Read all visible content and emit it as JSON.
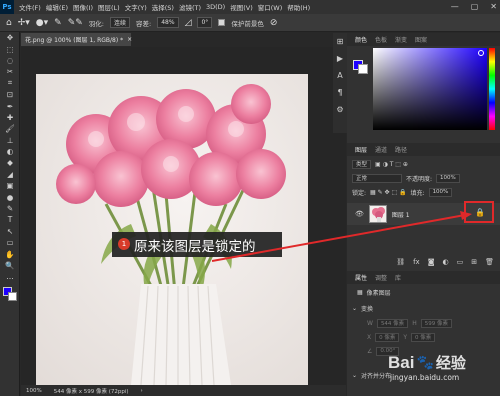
{
  "menubar": {
    "logo": "Ps",
    "items": [
      "文件(F)",
      "编辑(E)",
      "图像(I)",
      "图层(L)",
      "文字(Y)",
      "选择(S)",
      "滤镜(T)",
      "3D(D)",
      "视图(V)",
      "窗口(W)",
      "帮助(H)"
    ],
    "controls": [
      "—",
      "▢",
      "✕"
    ]
  },
  "options": {
    "feather_label": "羽化:",
    "sample_value": "连续",
    "tolerance_label": "容差:",
    "tolerance_value": "48%",
    "angle_value": "0°",
    "protect_fg_label": "保护前景色"
  },
  "document": {
    "tab_title": "花.png @ 100% (图层 1, RGB/8) *",
    "close": "×",
    "zoom": "100%",
    "dimensions": "544 像素 x 599 像素 (72ppi)"
  },
  "tools": [
    "✥",
    "⬚",
    "◌",
    "✂",
    "⌗",
    "⊡",
    "✒",
    "✚",
    "🖌",
    "⊥",
    "◐",
    "◆",
    "◢",
    "▣",
    "●",
    "✎",
    "T",
    "↖",
    "▭",
    "✋",
    "🔍",
    "…"
  ],
  "panel_strip_icons": [
    "⊞",
    "▶",
    "A",
    "¶",
    "⚙"
  ],
  "color_panel": {
    "tabs": [
      "颜色",
      "色板",
      "渐变",
      "图案"
    ],
    "fg_color": "#1d00ff",
    "bg_color": "#ffffff"
  },
  "layers_panel": {
    "tabs": [
      "图层",
      "通道",
      "路径"
    ],
    "filter_label": "类型",
    "blend_mode": "正常",
    "opacity_label": "不透明度:",
    "opacity_value": "100%",
    "lock_label": "锁定:",
    "fill_label": "填充:",
    "fill_value": "100%",
    "layer_name": "图层 1",
    "lock_icon_name": "lock-icon",
    "highlight_color": "#e0292a"
  },
  "properties_panel": {
    "tabs": [
      "属性",
      "调整",
      "库"
    ],
    "pixel_layer_label": "像素图层",
    "transform_label": "变换",
    "w_label": "W",
    "w_value": "544 像素",
    "h_label": "H",
    "h_value": "599 像素",
    "x_label": "X",
    "x_value": "0 像素",
    "y_label": "Y",
    "y_value": "0 像素",
    "angle_value": "0.00°",
    "align_label": "对齐并分布"
  },
  "callout": {
    "number": "1",
    "text": "原来该图层是锁定的"
  },
  "watermark": {
    "brand": "Bai",
    "brand2": "经验",
    "url": "jingyan.baidu.com"
  }
}
